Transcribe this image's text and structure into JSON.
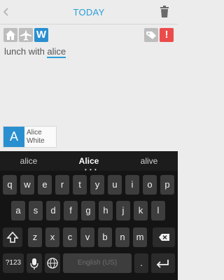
{
  "header": {
    "title": "TODAY",
    "back_icon": "chevron-left-icon",
    "trash_icon": "trash-icon"
  },
  "toolbar": {
    "home_icon": "home-icon",
    "plane_icon": "airplane-icon",
    "work_label": "W",
    "tag_icon": "tag-icon",
    "alert_label": "!"
  },
  "note": {
    "prefix": "lunch with ",
    "mention": "alice"
  },
  "contact": {
    "initial": "A",
    "first_name": "Alice",
    "last_name": "White"
  },
  "suggestions": {
    "left": "alice",
    "center": "Alice",
    "right": "alive",
    "dots": "• • •"
  },
  "keyboard": {
    "row1": [
      "q",
      "w",
      "e",
      "r",
      "t",
      "y",
      "u",
      "i",
      "o",
      "p"
    ],
    "row2": [
      "a",
      "s",
      "d",
      "f",
      "g",
      "h",
      "j",
      "k",
      "l"
    ],
    "row3": [
      "z",
      "x",
      "c",
      "v",
      "b",
      "n",
      "m"
    ],
    "sym_label": "?123",
    "space_label": "English (US)",
    "period_label": ".",
    "shift_icon": "shift-icon",
    "backspace_icon": "backspace-icon",
    "mic_icon": "microphone-icon",
    "globe_icon": "globe-icon",
    "enter_icon": "enter-icon"
  },
  "colors": {
    "accent": "#2a9fd8",
    "alert": "#ec4b4b",
    "work": "#2a8fd0"
  }
}
